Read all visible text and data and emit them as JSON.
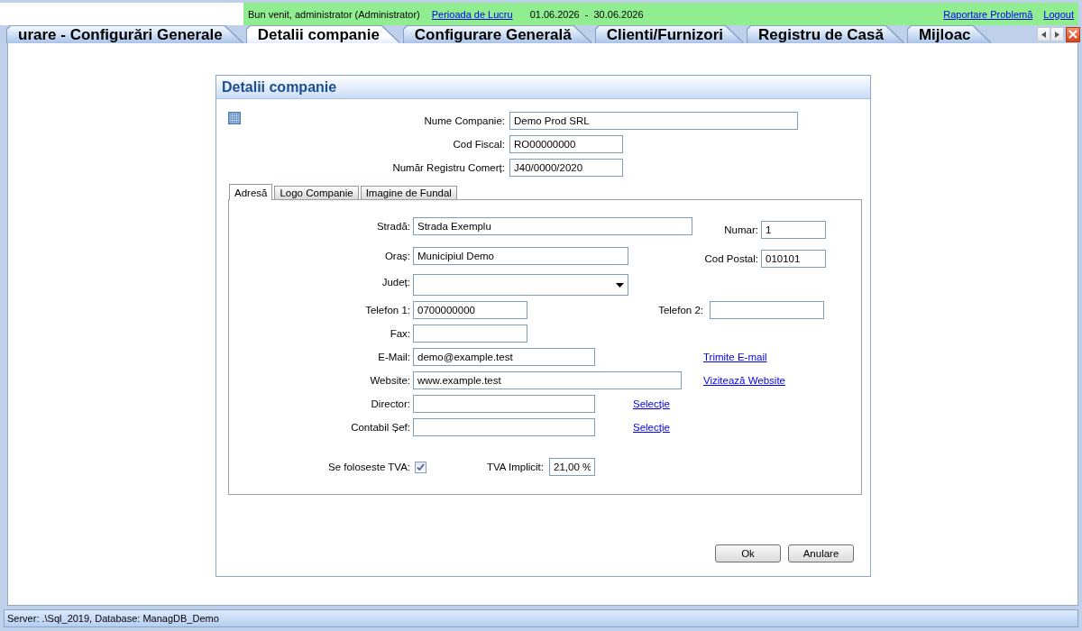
{
  "top_bar": {
    "welcome": "Bun venit, administrator (Administrator)",
    "period_link": "Perioada de Lucru",
    "period": "01.06.2026 - 30.06.2026",
    "report_link": "Raportare Problemă",
    "logout_link": "Logout"
  },
  "tabs": [
    {
      "label": "urare - Configurări Generale",
      "selected": false
    },
    {
      "label": "Detalii companie",
      "selected": true
    },
    {
      "label": "Configurare Generală",
      "selected": false
    },
    {
      "label": "Clienti/Furnizori",
      "selected": false
    },
    {
      "label": "Registru de Casă",
      "selected": false
    },
    {
      "label": "Mijloac",
      "selected": false
    }
  ],
  "dialog": {
    "title": "Detalii companie",
    "fields": [
      {
        "label": "Nume Companie:",
        "value": "Demo Prod SRL"
      },
      {
        "label": "Cod Fiscal:",
        "value": "RO00000000"
      },
      {
        "label": "Număr Registru Comerț:",
        "value": "J40/0000/2020"
      }
    ],
    "tabs": [
      {
        "label": "Adresă",
        "selected": true
      },
      {
        "label": "Logo Companie",
        "selected": false
      },
      {
        "label": "Imagine de Fundal",
        "selected": false
      }
    ],
    "address_rows": [
      {
        "items": [
          {
            "kind": "text",
            "label": "Stradă:",
            "value": "Strada Exemplu"
          },
          {
            "kind": "text",
            "label": "Numar:",
            "value": "1"
          }
        ]
      },
      {
        "items": [
          {
            "kind": "text",
            "label": "Oraș:",
            "value": "Municipiul Demo"
          },
          {
            "kind": "text",
            "label": "Cod Postal:",
            "value": "010101"
          }
        ]
      },
      {
        "items": [
          {
            "kind": "select",
            "label": "Județ:"
          }
        ]
      },
      {
        "items": [
          {
            "kind": "text",
            "label": "Telefon 1:",
            "value": "0700000000"
          },
          {
            "kind": "text",
            "label": "Telefon 2:"
          }
        ]
      },
      {
        "items": [
          {
            "kind": "text",
            "label": "Fax:"
          }
        ]
      },
      {
        "items": [
          {
            "kind": "text",
            "label": "E-Mail:",
            "value": "demo@example.test"
          },
          {
            "kind": "link",
            "text": "Trimite E-mail"
          }
        ]
      },
      {
        "items": [
          {
            "kind": "text",
            "label": "Website:",
            "value": "www.example.test"
          },
          {
            "kind": "link",
            "text": "Vizitează Website"
          }
        ]
      },
      {
        "items": [
          {
            "kind": "text",
            "label": "Director:"
          },
          {
            "kind": "link",
            "text": "Selecție"
          }
        ]
      },
      {
        "items": [
          {
            "kind": "text",
            "label": "Contabil Șef:"
          },
          {
            "kind": "link",
            "text": "Selecție"
          }
        ]
      },
      {
        "items": [
          {
            "kind": "checkbox",
            "label": "Se foloseste TVA:",
            "checked": true
          },
          {
            "kind": "text",
            "label": "TVA Implicit:",
            "value": "21,00 %"
          }
        ]
      }
    ],
    "buttons": [
      "Ok",
      "Anulare"
    ]
  },
  "status_bar": "Server: .\\Sql_2019, Database: ManagDB_Demo"
}
